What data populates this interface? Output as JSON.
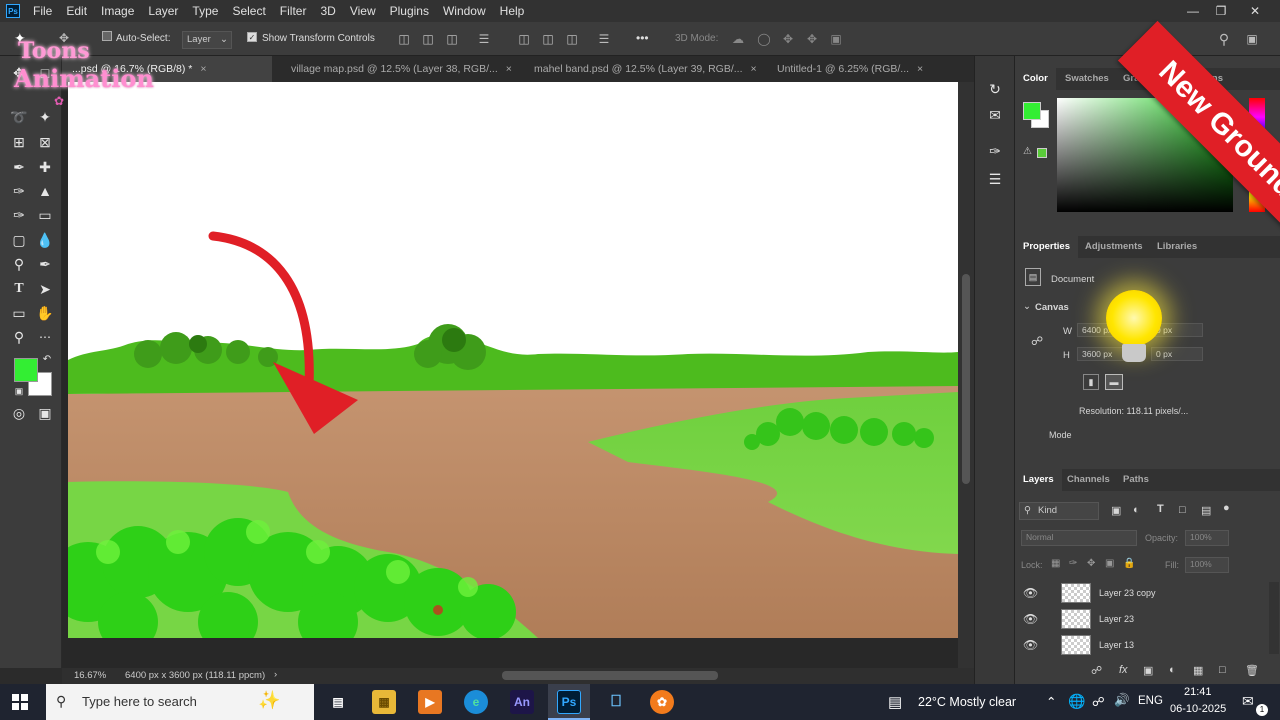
{
  "menu": [
    "File",
    "Edit",
    "Image",
    "Layer",
    "Type",
    "Select",
    "Filter",
    "3D",
    "View",
    "Plugins",
    "Window",
    "Help"
  ],
  "options": {
    "auto_select_label": "Auto-Select:",
    "layer_select_value": "Layer",
    "show_transform_label": "Show Transform Controls",
    "mode_3d_label": "3D Mode:",
    "more_label": "•••"
  },
  "tabs": [
    {
      "label": "...psd @ 16.7% (RGB/8) *",
      "active": true
    },
    {
      "label": "village map.psd @ 12.5% (Layer 38, RGB/...",
      "active": false
    },
    {
      "label": "mahel band.psd @ 12.5% (Layer 39, RGB/...",
      "active": false
    },
    {
      "label": "Untitled-1 @ 6.25% (RGB/...",
      "active": false
    }
  ],
  "status": {
    "zoom": "16.67%",
    "doc_info": "6400 px x 3600 px (118.11 ppcm)"
  },
  "color_panel": {
    "tabs": [
      "Color",
      "Swatches",
      "Gradients",
      "Patterns"
    ],
    "foreground": "#33ee33",
    "background": "#ffffff"
  },
  "properties_panel": {
    "tabs": [
      "Properties",
      "Adjustments",
      "Libraries"
    ],
    "document_label": "Document",
    "canvas_label": "Canvas",
    "w_label": "W",
    "h_label": "H",
    "w_value": "6400 px",
    "h_value": "3600 px",
    "x_value": "0 px",
    "y_value": "0 px",
    "resolution": "Resolution:  118.11  pixels/...",
    "mode_label": "Mode"
  },
  "layers_panel": {
    "tabs": [
      "Layers",
      "Channels",
      "Paths"
    ],
    "kind_label": "Kind",
    "blend_mode": "Normal",
    "opacity_label": "Opacity:",
    "opacity_value": "100%",
    "lock_label": "Lock:",
    "fill_label": "Fill:",
    "fill_value": "100%",
    "layers": [
      "Layer 23 copy",
      "Layer 23",
      "Layer 13"
    ]
  },
  "taskbar": {
    "search_placeholder": "Type here to search",
    "weather": "22°C  Mostly clear",
    "language": "ENG",
    "time": "21:41",
    "date": "06-10-2025",
    "notifications": "1",
    "apps": [
      "An",
      "Ps"
    ]
  },
  "overlay": {
    "banner_text": "New Ground Design",
    "watermark_line1": "Toons",
    "watermark_line2": "Animation"
  },
  "colors": {
    "accent_red": "#e01f26",
    "grass": "#5fd12a",
    "ground": "#b88662"
  }
}
